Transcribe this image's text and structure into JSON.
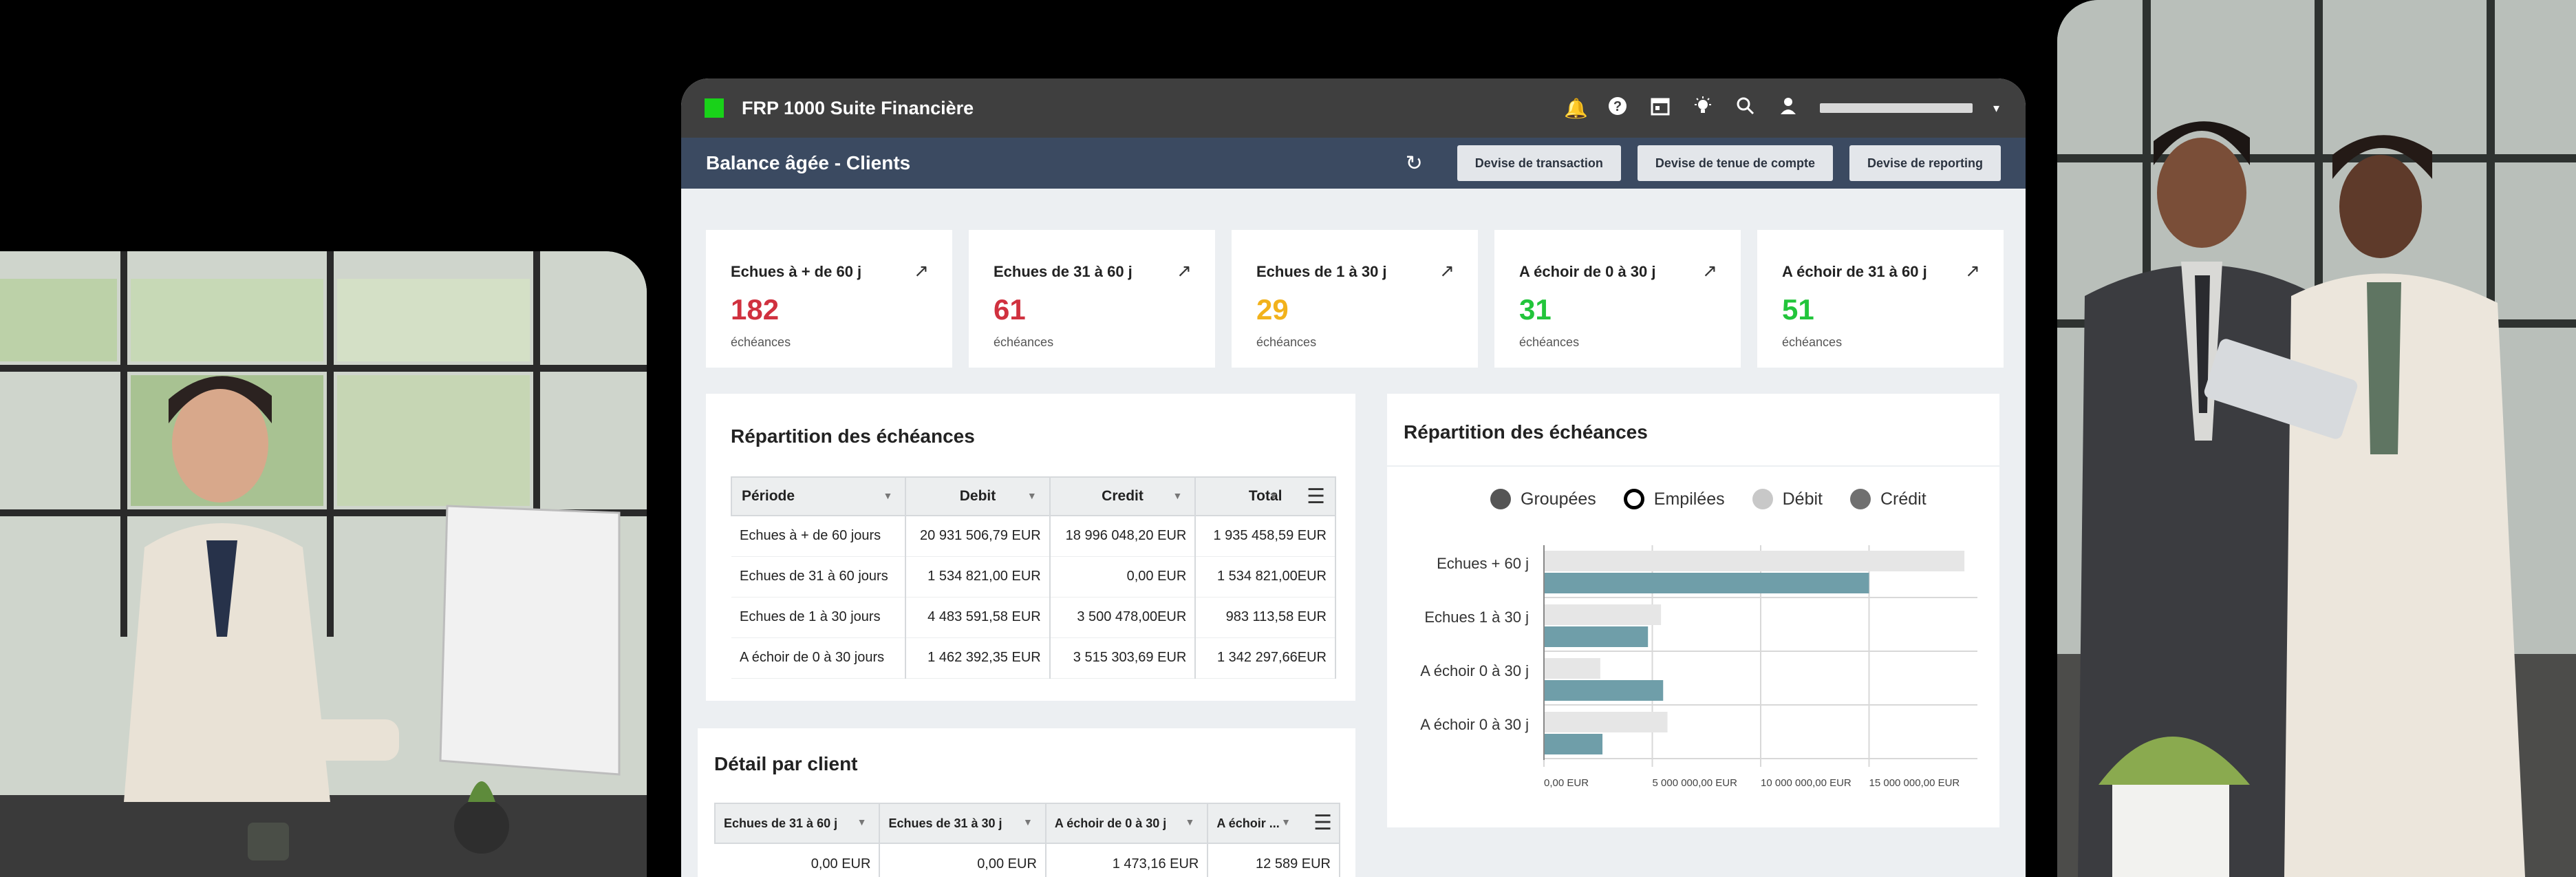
{
  "app": {
    "title": "FRP 1000 Suite Financière",
    "brand_color": "#19d219"
  },
  "titlebar_icons": [
    "bell-icon",
    "help-icon",
    "calendar-icon",
    "lightbulb-icon",
    "search-icon",
    "user-icon"
  ],
  "subheader": {
    "title": "Balance âgée - Clients",
    "buttons": [
      "Devise de transaction",
      "Devise de tenue de compte",
      "Devise de reporting"
    ]
  },
  "kpis": [
    {
      "title": "Echues à + de 60 j",
      "value": "182",
      "unit": "échéances",
      "color": "#d0313f"
    },
    {
      "title": "Echues de 31 à  60 j",
      "value": "61",
      "unit": "échéances",
      "color": "#d0313f"
    },
    {
      "title": "Echues de 1 à 30 j",
      "value": "29",
      "unit": "échéances",
      "color": "#f2b21b"
    },
    {
      "title": "A échoir de 0 à 30 j",
      "value": "31",
      "unit": "échéances",
      "color": "#22c53b"
    },
    {
      "title": "A échoir de 31 à 60 j",
      "value": "51",
      "unit": "échéances",
      "color": "#22c53b"
    }
  ],
  "repartition_table": {
    "title": "Répartition des échéances",
    "columns": [
      "Période",
      "Debit",
      "Credit",
      "Total"
    ],
    "rows": [
      [
        "Echues à + de 60 jours",
        "20 931 506,79 EUR",
        "18 996 048,20 EUR",
        "1 935 458,59 EUR"
      ],
      [
        "Echues de 31 à  60 jours",
        "1 534 821,00 EUR",
        "0,00 EUR",
        "1 534 821,00EUR"
      ],
      [
        "Echues de 1 à 30 jours",
        "4 483 591,58 EUR",
        "3 500 478,00EUR",
        "983 113,58 EUR"
      ],
      [
        "A échoir de 0 à 30 jours",
        "1 462 392,35 EUR",
        "3 515 303,69 EUR",
        "1 342 297,66EUR"
      ]
    ]
  },
  "detail_table": {
    "title": "Détail par client",
    "columns": [
      "Echues de 31 à  60 j",
      "Echues de 31 à  30 j",
      "A échoir de 0 à 30 j",
      "A échoir ..."
    ],
    "rows": [
      [
        "0,00 EUR",
        "0,00 EUR",
        "1 473,16 EUR",
        "12 589 EUR"
      ]
    ]
  },
  "chart_data": {
    "type": "bar",
    "orientation": "horizontal",
    "title": "Répartition des échéances",
    "legend": [
      {
        "name": "Groupées",
        "style": "filled",
        "color": "#555555"
      },
      {
        "name": "Empilées",
        "style": "outline",
        "color": "#000000"
      },
      {
        "name": "Débit",
        "style": "filled",
        "color": "#c8c8c8"
      },
      {
        "name": "Crédit",
        "style": "filled",
        "color": "#707070"
      }
    ],
    "legend_position": "top",
    "categories": [
      "Echues + 60 j",
      "Echues 1 à  30 j",
      "A échoir 0 à 30 j",
      "A échoir 0 à 30 j"
    ],
    "series": [
      {
        "values": [
          19400000,
          5400000,
          2600000,
          5700000
        ],
        "color": "#e6e6e6"
      },
      {
        "values": [
          15000000,
          4800000,
          5500000,
          2700000
        ],
        "color": "#6f9ea9"
      }
    ],
    "x_ticks": [
      "0,00 EUR",
      "5 000 000,00 EUR",
      "10 000 000,00 EUR",
      "15 000 000,00 EUR"
    ],
    "x_tick_values": [
      0,
      5000000,
      10000000,
      15000000
    ],
    "xlim": [
      0,
      20000000
    ],
    "grid": true
  }
}
